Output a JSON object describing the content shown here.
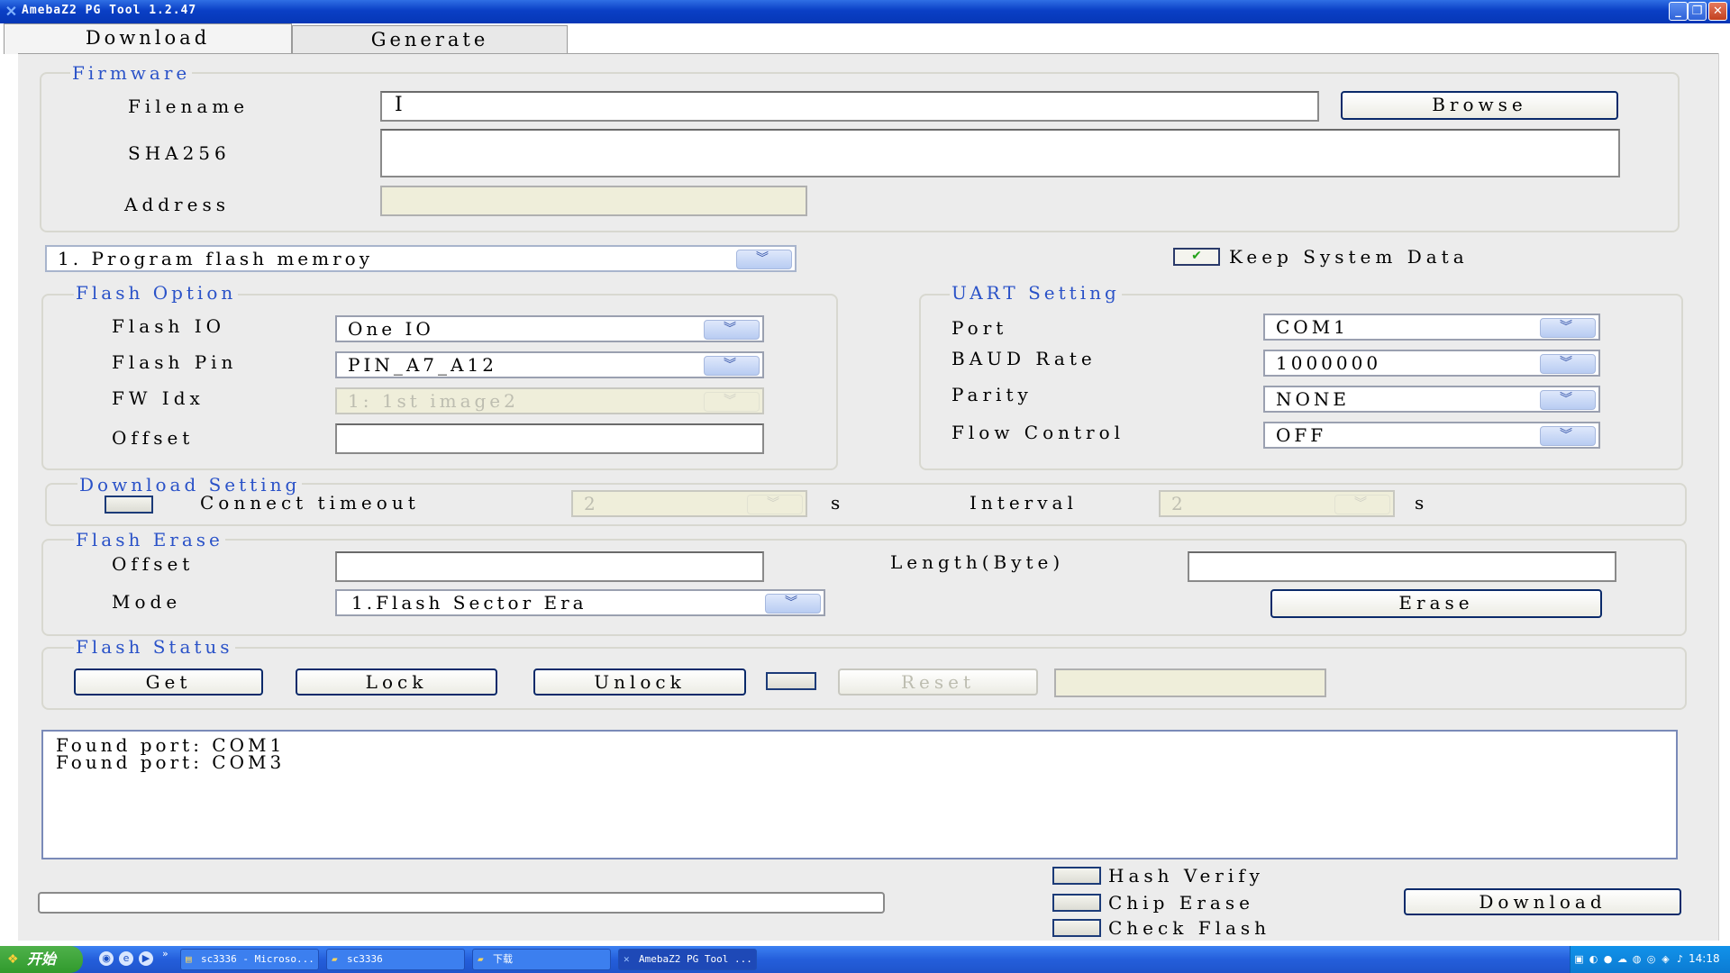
{
  "window": {
    "title": "AmebaZ2 PG Tool 1.2.47",
    "minimize": "_",
    "restore": "❐",
    "close": "✕"
  },
  "tabs": [
    {
      "label": "Download"
    },
    {
      "label": "Generate"
    }
  ],
  "firmware": {
    "legend": "Firmware",
    "filename_label": "Filename",
    "filename_value": "I",
    "browse_label": "Browse",
    "sha256_label": "SHA256",
    "sha256_value": "",
    "address_label": "Address",
    "address_value": ""
  },
  "program_mode": {
    "selected": "1. Program flash memroy"
  },
  "keep_system_data": {
    "label": "Keep System Data",
    "checked": true
  },
  "flash_option": {
    "legend": "Flash Option",
    "io_label": "Flash IO",
    "io_value": "One IO",
    "pin_label": "Flash Pin",
    "pin_value": "PIN_A7_A12",
    "fw_idx_label": "FW Idx",
    "fw_idx_value": "1: 1st image2",
    "offset_label": "Offset",
    "offset_value": ""
  },
  "uart_setting": {
    "legend": "UART Setting",
    "port_label": "Port",
    "port_value": "COM1",
    "baud_label": "BAUD Rate",
    "baud_value": "1000000",
    "parity_label": "Parity",
    "parity_value": "NONE",
    "flow_label": "Flow Control",
    "flow_value": "OFF"
  },
  "download_setting": {
    "legend": "Download Setting",
    "connect_timeout_label": "Connect timeout",
    "connect_timeout_value": "2",
    "unit1": "s",
    "interval_label": "Interval",
    "interval_value": "2",
    "unit2": "s"
  },
  "flash_erase": {
    "legend": "Flash Erase",
    "offset_label": "Offset",
    "offset_value": "",
    "length_label": "Length(Byte)",
    "length_value": "",
    "mode_label": "Mode",
    "mode_value": "1.Flash Sector Era",
    "erase_label": "Erase"
  },
  "flash_status": {
    "legend": "Flash Status",
    "get_label": "Get",
    "lock_label": "Lock",
    "unlock_label": "Unlock",
    "reset_label": "Reset",
    "status_value": ""
  },
  "log": {
    "lines": "Found port: COM1\nFound port: COM3"
  },
  "options": {
    "hash_verify": "Hash Verify",
    "chip_erase": "Chip Erase",
    "check_flash": "Check Flash"
  },
  "download_button": "Download",
  "taskbar": {
    "start": "开始",
    "items": [
      {
        "label": "sc3336 - Microso..."
      },
      {
        "label": "sc3336"
      },
      {
        "label": "下载"
      },
      {
        "label": "AmebaZ2 PG Tool ..."
      }
    ],
    "clock": "14:18"
  }
}
